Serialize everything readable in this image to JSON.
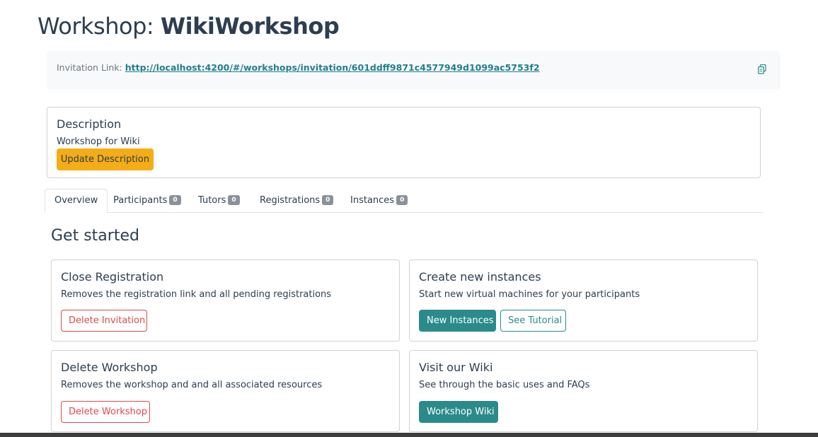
{
  "header": {
    "title_prefix": "Workshop: ",
    "title_name": "WikiWorkshop"
  },
  "invitation": {
    "label": "Invitation Link: ",
    "url": "http://localhost:4200/#/workshops/invitation/601ddff9871c4577949d1099ac5753f2",
    "copy_icon": "copy-icon"
  },
  "description": {
    "title": "Description",
    "text": "Workshop for Wiki",
    "update_button": "Update Description"
  },
  "tabs": [
    {
      "label": "Overview",
      "count": null,
      "active": true
    },
    {
      "label": "Participants",
      "count": "0",
      "active": false
    },
    {
      "label": "Tutors",
      "count": "0",
      "active": false
    },
    {
      "label": "Registrations",
      "count": "0",
      "active": false
    },
    {
      "label": "Instances",
      "count": "0",
      "active": false
    }
  ],
  "get_started": {
    "title": "Get started",
    "cards": {
      "close_registration": {
        "title": "Close Registration",
        "text": "Removes the registration link and all pending registrations",
        "button": "Delete Invitation"
      },
      "create_instances": {
        "title": "Create new instances",
        "text": "Start new virtual machines for your participants",
        "button_primary": "New Instances",
        "button_secondary": "See Tutorial"
      },
      "delete_workshop": {
        "title": "Delete Workshop",
        "text": "Removes the workshop and and all associated resources",
        "button": "Delete Workshop"
      },
      "visit_wiki": {
        "title": "Visit our Wiki",
        "text": "See through the basic uses and FAQs",
        "button": "Workshop Wiki"
      }
    }
  },
  "colors": {
    "accent": "#2b8b8b",
    "warning": "#f5ad16",
    "danger": "#dc4b4b",
    "link": "#20818a",
    "text": "#2c3e50"
  }
}
